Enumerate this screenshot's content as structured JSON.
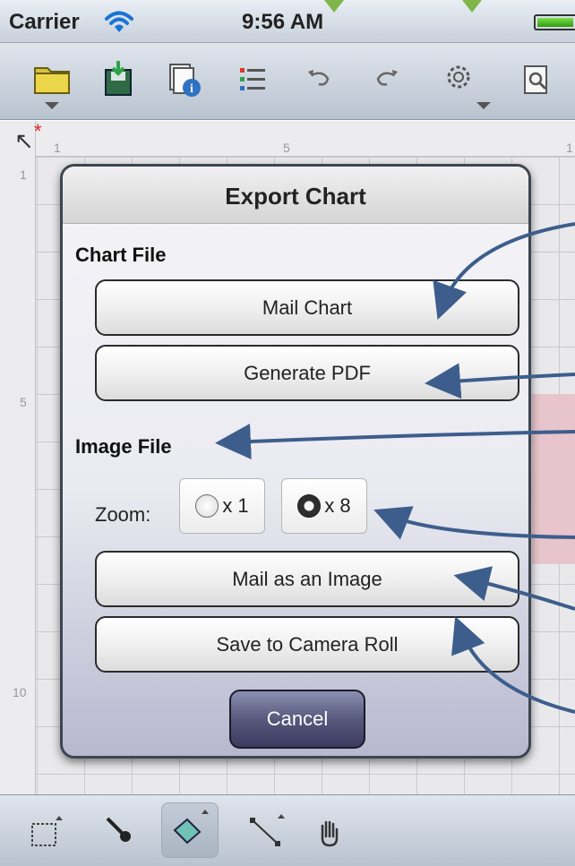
{
  "status_bar": {
    "carrier": "Carrier",
    "time": "9:56 AM"
  },
  "toolbar": {
    "icons": [
      "folder-icon",
      "save-icon",
      "info-icon",
      "list-icon",
      "undo-icon",
      "redo-icon",
      "settings-icon",
      "preview-icon"
    ]
  },
  "canvas": {
    "ruler_top": [
      "1",
      "5",
      "1"
    ],
    "ruler_left": [
      "1",
      "5",
      "10"
    ],
    "modified_marker": "*"
  },
  "dialog": {
    "title": "Export Chart",
    "chart_file_label": "Chart File",
    "mail_chart": "Mail Chart",
    "generate_pdf": "Generate PDF",
    "image_file_label": "Image File",
    "zoom_label": "Zoom:",
    "zoom_options": [
      {
        "label": "x 1",
        "selected": false
      },
      {
        "label": "x 8",
        "selected": true
      }
    ],
    "mail_image": "Mail as an Image",
    "save_camera_roll": "Save to Camera Roll",
    "cancel": "Cancel"
  },
  "bottom_toolbar": {
    "icons": [
      "select-icon",
      "eyedropper-icon",
      "eraser-icon",
      "line-icon",
      "hand-icon"
    ],
    "active": "eraser-icon"
  },
  "colors": {
    "annotation_arrow": "#3d5e8c",
    "top_arrow": "#7fb54a",
    "cancel_button": "#4b4d72"
  }
}
